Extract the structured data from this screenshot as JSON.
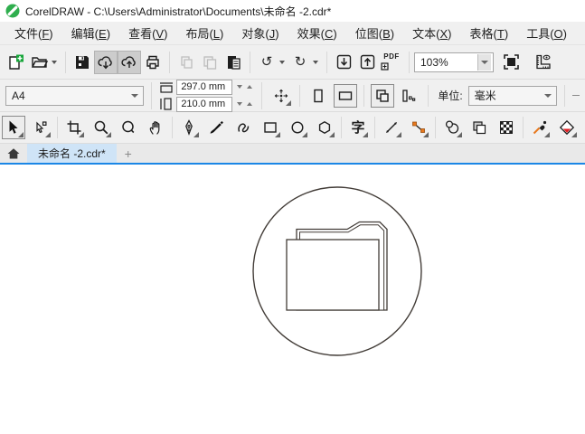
{
  "titlebar": {
    "app_icon": "coreldraw-logo",
    "title": "CorelDRAW - C:\\Users\\Administrator\\Documents\\未命名 -2.cdr*"
  },
  "menubar": {
    "items": [
      {
        "id": "file",
        "pre": "文件(",
        "key": "F",
        "post": ")"
      },
      {
        "id": "edit",
        "pre": "编辑(",
        "key": "E",
        "post": ")"
      },
      {
        "id": "view",
        "pre": "查看(",
        "key": "V",
        "post": ")"
      },
      {
        "id": "layout",
        "pre": "布局(",
        "key": "L",
        "post": ")"
      },
      {
        "id": "object",
        "pre": "对象(",
        "key": "J",
        "post": ")"
      },
      {
        "id": "effects",
        "pre": "效果(",
        "key": "C",
        "post": ")"
      },
      {
        "id": "bitmaps",
        "pre": "位图(",
        "key": "B",
        "post": ")"
      },
      {
        "id": "text",
        "pre": "文本(",
        "key": "X",
        "post": ")"
      },
      {
        "id": "table",
        "pre": "表格(",
        "key": "T",
        "post": ")"
      },
      {
        "id": "tools",
        "pre": "工具(",
        "key": "O",
        "post": ")"
      }
    ]
  },
  "toolbar": {
    "zoom_level": "103%",
    "pdf_label": "PDF",
    "undo_glyph": "↺",
    "redo_glyph": "↻",
    "buttons": [
      "new-document",
      "open",
      "save",
      "cloud-download",
      "cloud-upload",
      "print",
      "cut",
      "copy",
      "paste",
      "undo",
      "redo",
      "import",
      "export",
      "publish-pdf",
      "zoom-level",
      "full-screen-preview",
      "show-rulers"
    ],
    "pressed_buttons": [
      "cloud-download",
      "cloud-upload"
    ],
    "disabled_buttons": [
      "cut",
      "copy"
    ]
  },
  "property_bar": {
    "paper_size": "A4",
    "page_width": "297.0 mm",
    "page_height": "210.0 mm",
    "units_label": "单位:",
    "unit": "毫米",
    "buttons": [
      "nudge-offset",
      "portrait",
      "landscape",
      "all-pages-size",
      "current-page-size"
    ],
    "selected_buttons": [
      "landscape",
      "all-pages-size"
    ]
  },
  "toolbox": {
    "text_tool_glyph": "字",
    "tools": [
      "pick",
      "shape",
      "crop",
      "zoom",
      "magnifier",
      "pan",
      "pen",
      "brush",
      "curve",
      "rectangle",
      "ellipse",
      "polygon",
      "text",
      "dimension-line",
      "connector",
      "drop-shadow",
      "transparency",
      "pattern-fill",
      "color-eyedropper",
      "interactive-fill",
      "smart-fill"
    ],
    "selected_tool": "pick"
  },
  "tabbar": {
    "active_tab": "未命名 -2.cdr*",
    "new_tab_label": "+"
  },
  "canvas": {
    "drawing": {
      "shapes": [
        "circle-outline",
        "folder-outline"
      ],
      "stroke_color": "#423c37"
    }
  },
  "colors": {
    "accent_blue": "#1b87e6",
    "tab_active_bg": "#cfe4f7",
    "bar_bg": "#f0f0f0",
    "plus_green": "#17a63a",
    "node_orange": "#e8791e",
    "fill_red": "#e21d22",
    "icon_dark": "#1e1e1e",
    "disabled_gray": "#bdbdbd"
  }
}
